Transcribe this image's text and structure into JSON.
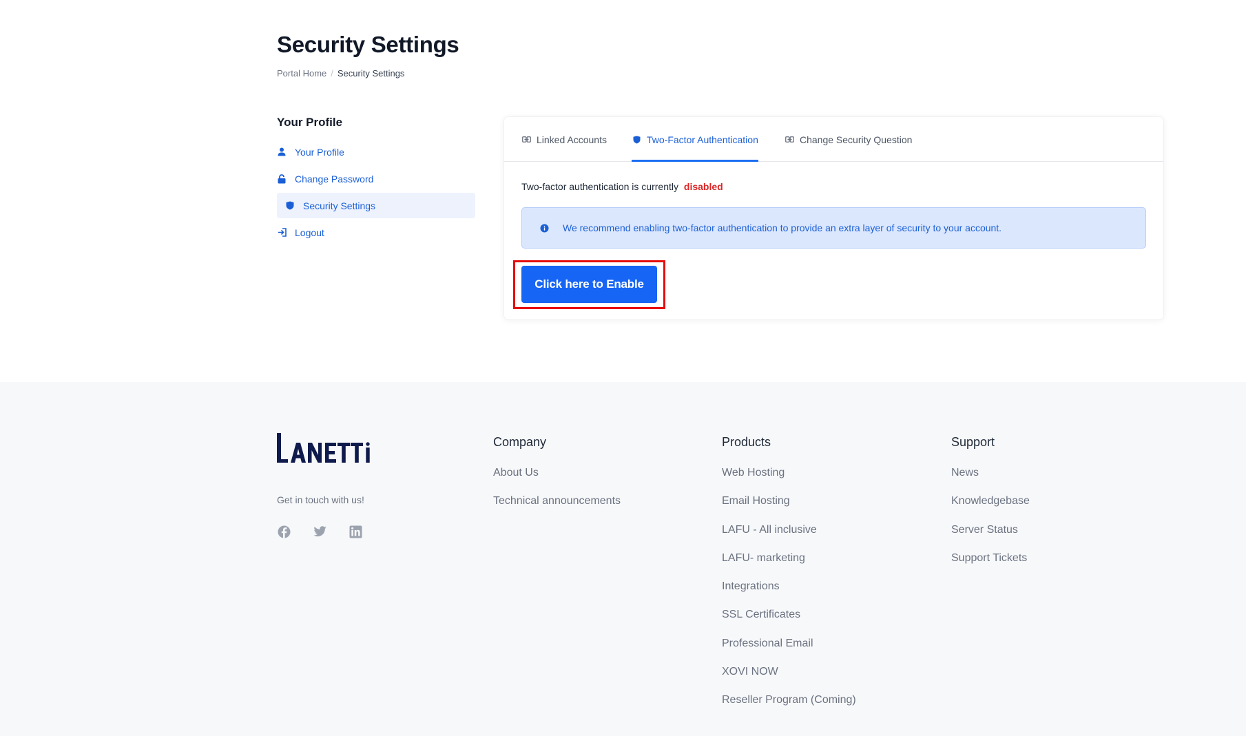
{
  "page": {
    "title": "Security Settings",
    "breadcrumb": {
      "home": "Portal Home",
      "separator": "/",
      "current": "Security Settings"
    }
  },
  "sidebar": {
    "title": "Your Profile",
    "items": [
      {
        "label": "Your Profile",
        "icon": "user-icon"
      },
      {
        "label": "Change Password",
        "icon": "lock-icon"
      },
      {
        "label": "Security Settings",
        "icon": "shield-icon",
        "active": true
      },
      {
        "label": "Logout",
        "icon": "logout-icon"
      }
    ]
  },
  "tabs": [
    {
      "label": "Linked Accounts",
      "icon": "link-icon"
    },
    {
      "label": "Two-Factor Authentication",
      "icon": "shield-icon",
      "active": true
    },
    {
      "label": "Change Security Question",
      "icon": "link-icon"
    }
  ],
  "two_factor": {
    "status_text": "Two-factor authentication is currently",
    "status_value": "disabled",
    "alert_text": "We recommend enabling two-factor authentication to provide an extra layer of security to your account.",
    "enable_button": "Click here to Enable"
  },
  "footer": {
    "logo_text": "LANETTI",
    "tagline": "Get in touch with us!",
    "socials": [
      "facebook-icon",
      "twitter-icon",
      "linkedin-icon"
    ],
    "columns": [
      {
        "title": "Company",
        "links": [
          "About Us",
          "Technical announcements"
        ]
      },
      {
        "title": "Products",
        "links": [
          "Web Hosting",
          "Email Hosting",
          "LAFU - All inclusive",
          "LAFU- marketing",
          "Integrations",
          "SSL Certificates",
          "Professional Email",
          "XOVI NOW",
          "Reseller Program (Coming)"
        ]
      },
      {
        "title": "Support",
        "links": [
          "News",
          "Knowledgebase",
          "Server Status",
          "Support Tickets"
        ]
      }
    ]
  },
  "colors": {
    "accent": "#1B5FD6",
    "button": "#1665F4",
    "danger": "#DC2626",
    "highlight_border": "#E60D0D",
    "alert_bg": "#DBE7FD",
    "footer_bg": "#F7F8FA",
    "logo": "#0F1B4C"
  }
}
